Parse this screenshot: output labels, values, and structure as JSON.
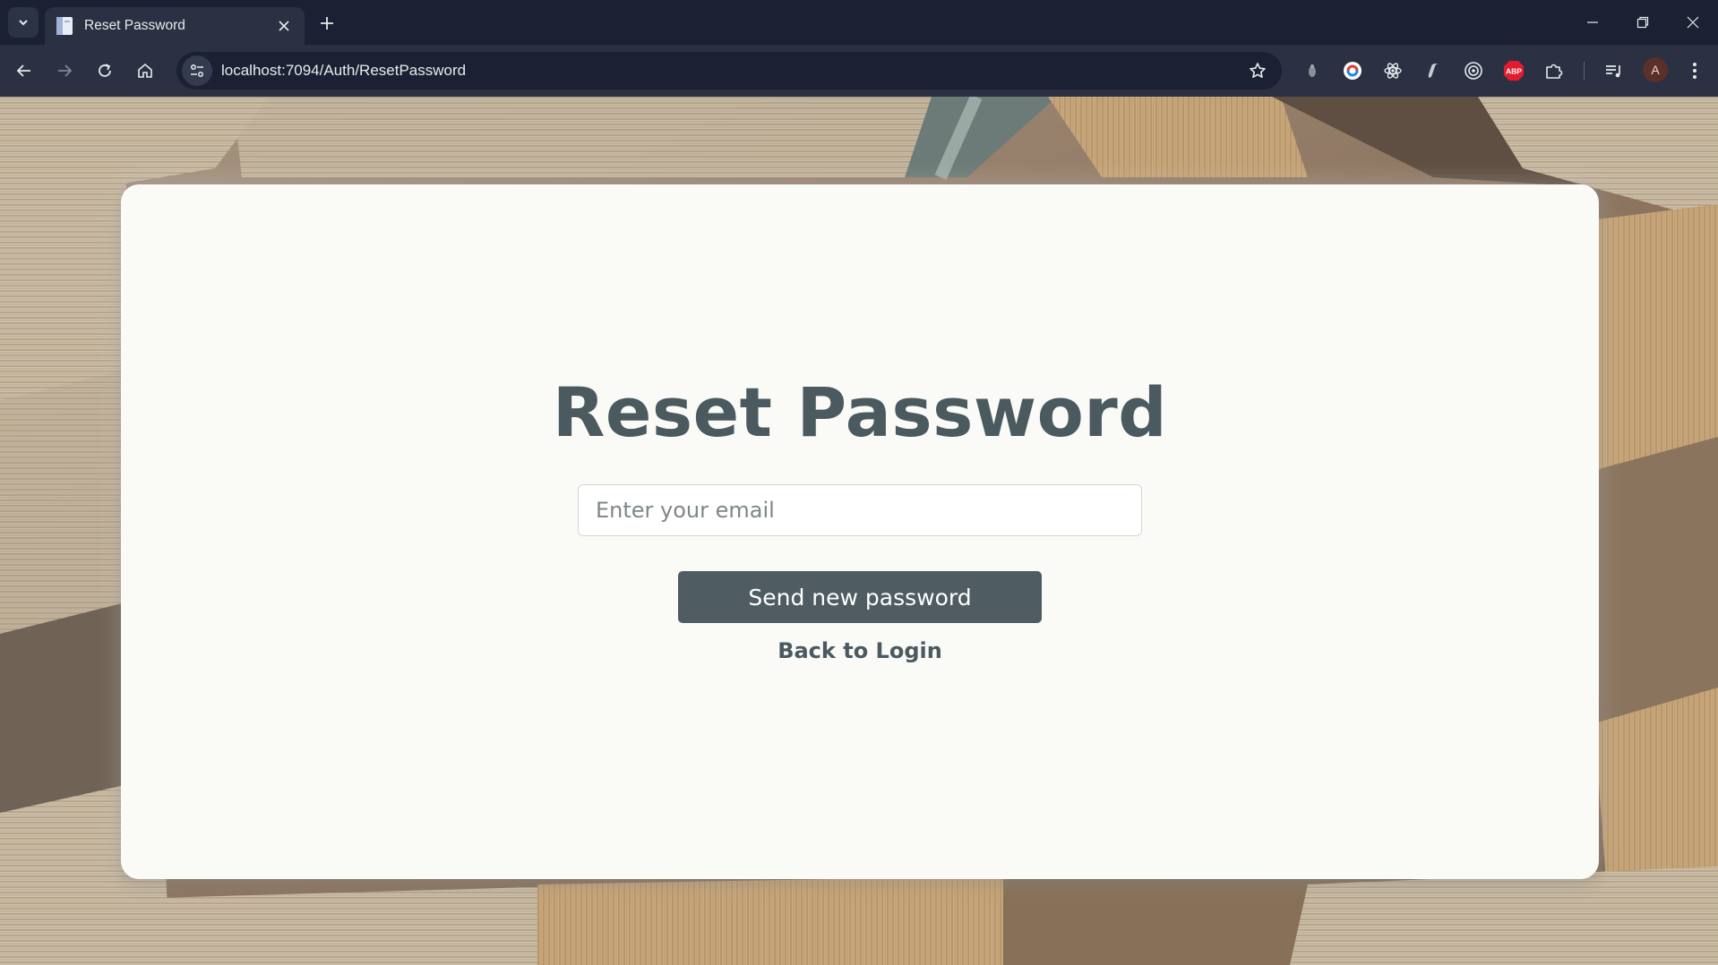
{
  "browser": {
    "tab": {
      "title": "Reset Password",
      "favicon": "document-icon"
    },
    "address_bar": {
      "url": "localhost:7094/Auth/ResetPassword"
    },
    "extensions": [
      "ext-dot-icon",
      "ext-grammar-icon",
      "ext-react-icon",
      "ext-script-icon",
      "ext-target-icon",
      "ext-abp-icon",
      "extensions-puzzle-icon"
    ],
    "abp_badge": "ABP",
    "profile_initial": "A"
  },
  "page": {
    "title": "Reset Password",
    "email": {
      "value": "",
      "placeholder": "Enter your email"
    },
    "submit_label": "Send new password",
    "back_link": "Back to Login"
  },
  "colors": {
    "card_background": "#fafaf7",
    "text_primary": "#4b5a5f",
    "button_background": "#4f5d62",
    "browser_frame": "#1b2133",
    "browser_toolbar": "#2b3142"
  }
}
